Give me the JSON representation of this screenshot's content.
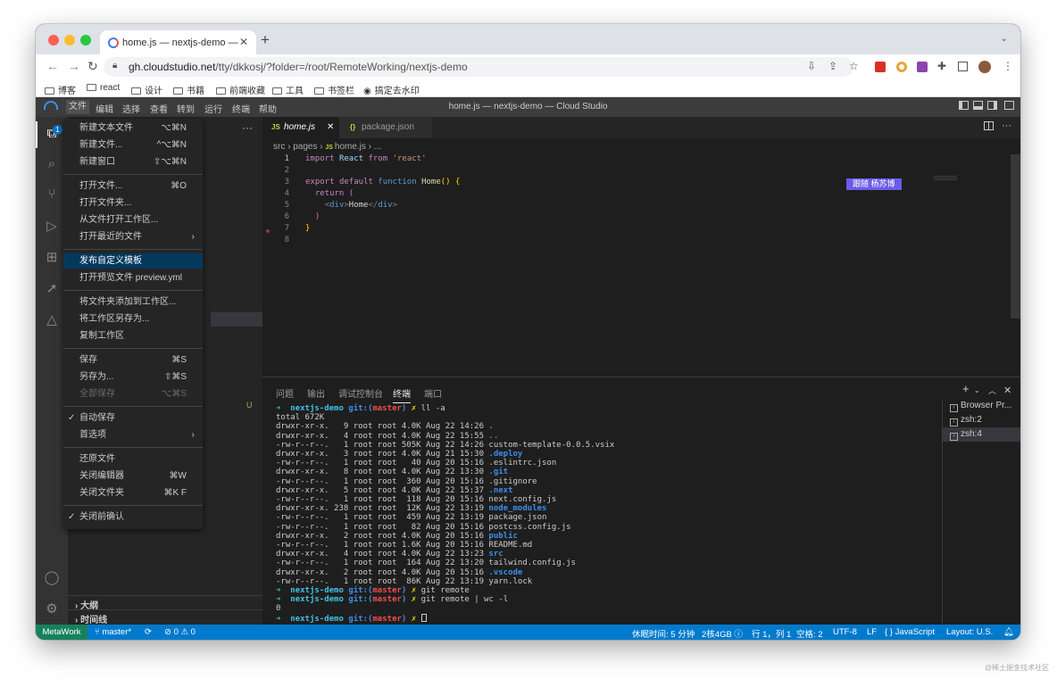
{
  "browser": {
    "tab_title": "home.js — nextjs-demo — Cloud Studio",
    "url_host": "gh.cloudstudio.net",
    "url_path": "/tty/dkkosj/?folder=/root/RemoteWorking/nextjs-demo",
    "bookmarks": [
      {
        "label": "博客"
      },
      {
        "label": "react"
      },
      {
        "label": "设计"
      },
      {
        "label": "书籍"
      },
      {
        "label": "前端收藏"
      },
      {
        "label": "工具"
      },
      {
        "label": "书签栏"
      },
      {
        "label": "搞定去水印"
      }
    ]
  },
  "titlebar": {
    "menus": [
      "文件",
      "编辑",
      "选择",
      "查看",
      "转到",
      "运行",
      "终端",
      "帮助"
    ],
    "title": "home.js — nextjs-demo — Cloud Studio"
  },
  "activity": {
    "badge": "1"
  },
  "sidebar": {
    "status_letter": "U",
    "outline_label": "大纲",
    "timeline_label": "时间线"
  },
  "editor": {
    "tabs": [
      {
        "icon": "JS",
        "label": "home.js",
        "close": "✕"
      },
      {
        "icon": "{}",
        "label": "package.json"
      }
    ],
    "breadcrumb": [
      "src",
      "pages",
      "home.js",
      "..."
    ],
    "follow_badge": "跟随  杨苏博",
    "line_numbers": [
      "1",
      "2",
      "3",
      "4",
      "5",
      "6",
      "7",
      "8"
    ]
  },
  "panel": {
    "tabs": [
      "问题",
      "输出",
      "调试控制台",
      "终端",
      "端口"
    ],
    "active_tab": "终端",
    "terminals": [
      {
        "label": "Browser Pr..."
      },
      {
        "label": "zsh:2"
      },
      {
        "label": "zsh:4"
      }
    ],
    "ls_lines": [
      {
        "perm": "drwxr-xr-x.",
        "n": "  9",
        "size": "4.0K",
        "date": "Aug 22 14:26",
        "name": ".",
        "kind": "dir"
      },
      {
        "perm": "drwxr-xr-x.",
        "n": "  4",
        "size": "4.0K",
        "date": "Aug 22 15:55",
        "name": "..",
        "kind": "dir"
      },
      {
        "perm": "-rw-r--r--.",
        "n": "  1",
        "size": "505K",
        "date": "Aug 22 14:26",
        "name": "custom-template-0.0.5.vsix",
        "kind": "file"
      },
      {
        "perm": "drwxr-xr-x.",
        "n": "  3",
        "size": "4.0K",
        "date": "Aug 21 15:30",
        "name": ".deploy",
        "kind": "dir"
      },
      {
        "perm": "-rw-r--r--.",
        "n": "  1",
        "size": "  40",
        "date": "Aug 20 15:16",
        "name": ".eslintrc.json",
        "kind": "file"
      },
      {
        "perm": "drwxr-xr-x.",
        "n": "  8",
        "size": "4.0K",
        "date": "Aug 22 13:30",
        "name": ".git",
        "kind": "dir"
      },
      {
        "perm": "-rw-r--r--.",
        "n": "  1",
        "size": " 360",
        "date": "Aug 20 15:16",
        "name": ".gitignore",
        "kind": "file"
      },
      {
        "perm": "drwxr-xr-x.",
        "n": "  5",
        "size": "4.0K",
        "date": "Aug 22 15:37",
        "name": ".next",
        "kind": "dir"
      },
      {
        "perm": "-rw-r--r--.",
        "n": "  1",
        "size": " 118",
        "date": "Aug 20 15:16",
        "name": "next.config.js",
        "kind": "file"
      },
      {
        "perm": "drwxr-xr-x.",
        "n": "238",
        "size": " 12K",
        "date": "Aug 22 13:19",
        "name": "node_modules",
        "kind": "dir"
      },
      {
        "perm": "-rw-r--r--.",
        "n": "  1",
        "size": " 459",
        "date": "Aug 22 13:19",
        "name": "package.json",
        "kind": "file"
      },
      {
        "perm": "-rw-r--r--.",
        "n": "  1",
        "size": "  82",
        "date": "Aug 20 15:16",
        "name": "postcss.config.js",
        "kind": "file"
      },
      {
        "perm": "drwxr-xr-x.",
        "n": "  2",
        "size": "4.0K",
        "date": "Aug 20 15:16",
        "name": "public",
        "kind": "dir"
      },
      {
        "perm": "-rw-r--r--.",
        "n": "  1",
        "size": "1.6K",
        "date": "Aug 20 15:16",
        "name": "README.md",
        "kind": "file"
      },
      {
        "perm": "drwxr-xr-x.",
        "n": "  4",
        "size": "4.0K",
        "date": "Aug 22 13:23",
        "name": "src",
        "kind": "dir"
      },
      {
        "perm": "-rw-r--r--.",
        "n": "  1",
        "size": " 164",
        "date": "Aug 22 13:20",
        "name": "tailwind.config.js",
        "kind": "file"
      },
      {
        "perm": "drwxr-xr-x.",
        "n": "  2",
        "size": "4.0K",
        "date": "Aug 20 15:16",
        "name": ".vscode",
        "kind": "dir"
      },
      {
        "perm": "-rw-r--r--.",
        "n": "  1",
        "size": " 86K",
        "date": "Aug 22 13:19",
        "name": "yarn.lock",
        "kind": "file"
      }
    ],
    "prompt_dir": "nextjs-demo",
    "prompt_git": "git:(",
    "prompt_branch": "master",
    "prompt_close": ")",
    "cmd1": "ll -a",
    "total": "total 672K",
    "owner": "root root",
    "cmd2": "git remote",
    "cmd3": "git remote | wc -l",
    "result": "0"
  },
  "menu": {
    "items": [
      {
        "label": "新建文本文件",
        "key": "⌥⌘N"
      },
      {
        "label": "新建文件...",
        "key": "^⌥⌘N"
      },
      {
        "label": "新建窗口",
        "key": "⇧⌥⌘N"
      },
      {
        "label": "打开文件...",
        "key": "⌘O"
      },
      {
        "label": "打开文件夹..."
      },
      {
        "label": "从文件打开工作区..."
      },
      {
        "label": "打开最近的文件"
      },
      {
        "label": "发布自定义模板"
      },
      {
        "label": "打开预览文件 preview.yml"
      },
      {
        "label": "将文件夹添加到工作区..."
      },
      {
        "label": "将工作区另存为..."
      },
      {
        "label": "复制工作区"
      },
      {
        "label": "保存",
        "key": "⌘S"
      },
      {
        "label": "另存为...",
        "key": "⇧⌘S"
      },
      {
        "label": "全部保存",
        "key": "⌥⌘S"
      },
      {
        "label": "自动保存"
      },
      {
        "label": "首选项"
      },
      {
        "label": "还原文件"
      },
      {
        "label": "关闭编辑器",
        "key": "⌘W"
      },
      {
        "label": "关闭文件夹",
        "key": "⌘K F"
      },
      {
        "label": "关闭前确认"
      }
    ]
  },
  "statusbar": {
    "remote": "MetaWork",
    "branch": "master*",
    "problems": "⊘ 0 ⚠ 0",
    "rest_time": "休眠时间: 5 分钟",
    "machine": "2核4GB",
    "position": "行 1，列 1",
    "spaces": "空格: 2",
    "encoding": "UTF-8",
    "eol": "LF",
    "language": "JavaScript",
    "layout": "Layout: U.S."
  },
  "watermark": "@稀土掘金技术社区"
}
